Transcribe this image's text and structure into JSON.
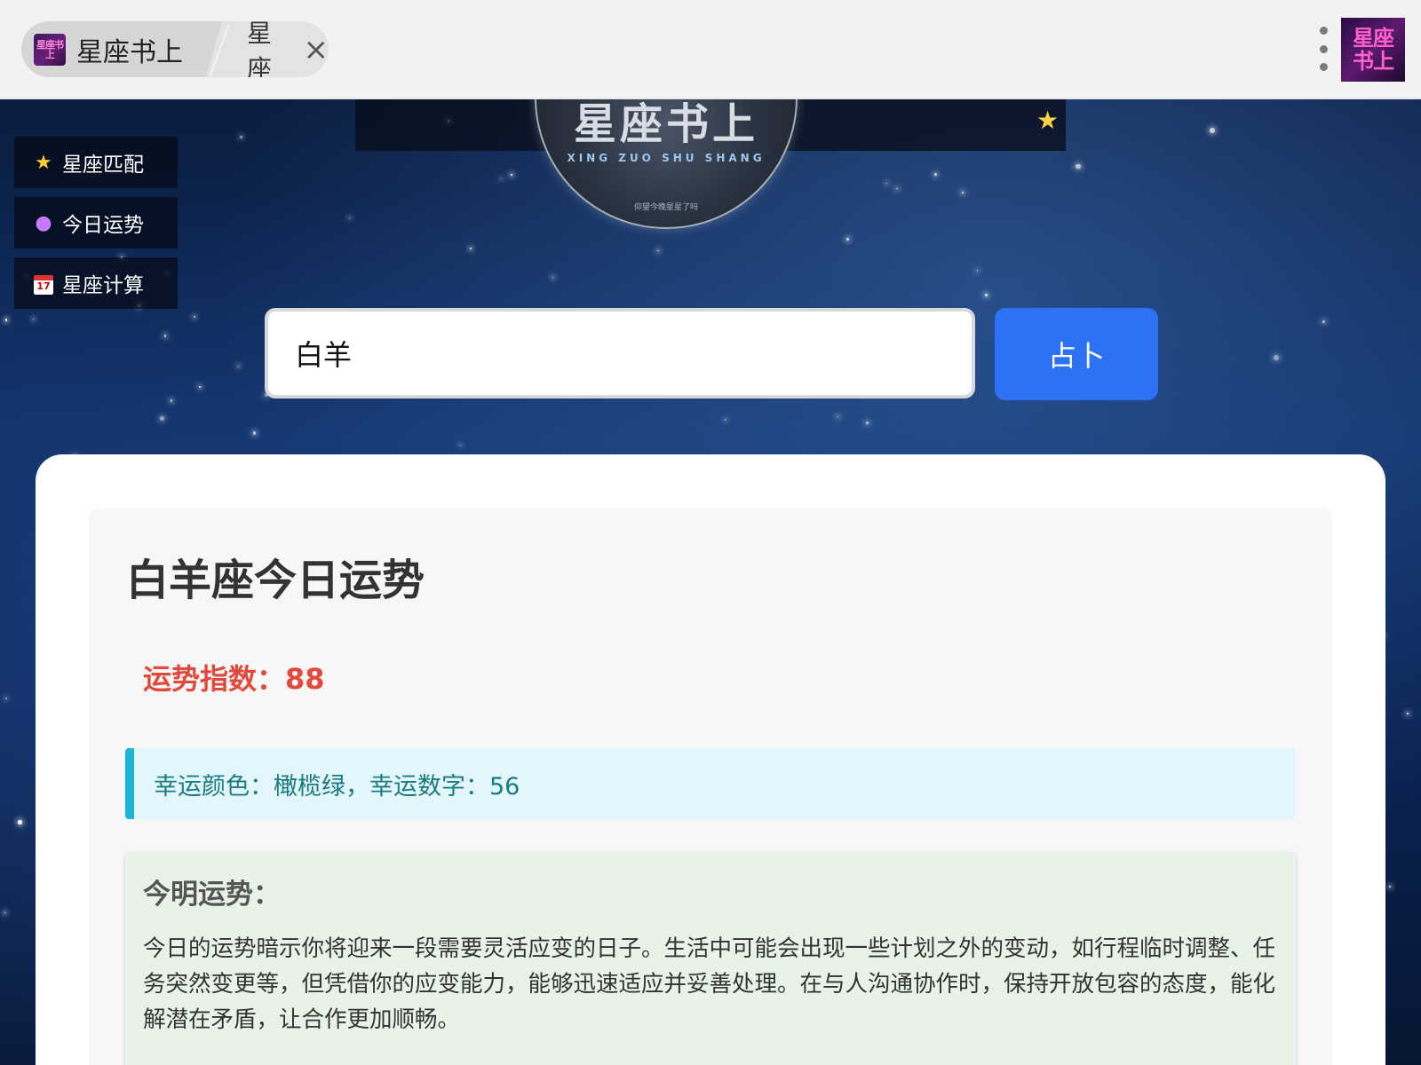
{
  "browser": {
    "tab_logo_text": "星座书上",
    "tab_title": "星座书上",
    "tab_second_label": "星座",
    "tab_close_icon": "×",
    "app_avatar_text": "星座书上"
  },
  "hero": {
    "logo_title": "星座书上",
    "logo_pinyin": "XING ZUO SHU SHANG",
    "logo_small_text": "仰望今晚星星了吗"
  },
  "nav": {
    "items": [
      {
        "icon": "star-icon",
        "glyph": "★",
        "label": "星座匹配"
      },
      {
        "icon": "crystal-ball-icon",
        "glyph": "●",
        "label": "今日运势"
      },
      {
        "icon": "calendar-icon",
        "glyph": "17",
        "label": "星座计算"
      }
    ]
  },
  "search": {
    "value": "白羊",
    "button_label": "占卜"
  },
  "result": {
    "title": "白羊座今日运势",
    "score_text": "运势指数：88",
    "lucky_text": "幸运颜色：橄榄绿，幸运数字：56",
    "forecast_title": "今明运势：",
    "forecast_text": "今日的运势暗示你将迎来一段需要灵活应变的日子。生活中可能会出现一些计划之外的变动，如行程临时调整、任务突然变更等，但凭借你的应变能力，能够迅速适应并妥善处理。在与人沟通协作时，保持开放包容的态度，能化解潜在矛盾，让合作更加顺畅。"
  },
  "colors": {
    "accent_button": "#2d72f4",
    "score_red": "#e04a3c",
    "lucky_border": "#19b6d6",
    "lucky_bg": "#e3f6fb",
    "forecast_bg": "#e7f3e6"
  }
}
